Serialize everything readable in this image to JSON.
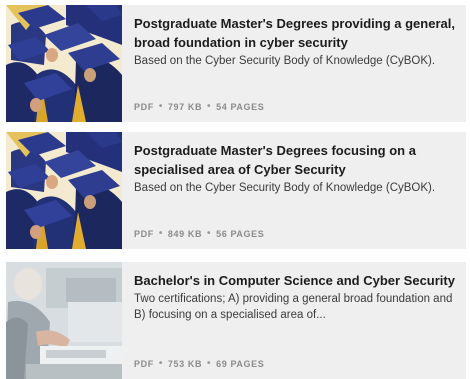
{
  "documents": [
    {
      "title": "Postgraduate Master's Degrees providing a general, broad foundation in cyber security",
      "description": "Based on the Cyber Security Body of Knowledge (CyBOK).",
      "format": "PDF",
      "size": "797 KB",
      "pages": "54 PAGES",
      "image": "graduation-caps"
    },
    {
      "title": "Postgraduate Master's Degrees focusing on a specialised area of Cyber Security",
      "description": "Based on the Cyber Security Body of Knowledge (CyBOK).",
      "format": "PDF",
      "size": "849 KB",
      "pages": "56 PAGES",
      "image": "graduation-caps"
    },
    {
      "title": "Bachelor's in Computer Science and Cyber Security",
      "description": "Two certifications; A) providing a general broad foundation and B) focusing on a specialised area of...",
      "format": "PDF",
      "size": "753 KB",
      "pages": "69 PAGES",
      "image": "person-at-computer"
    }
  ],
  "meta_separator": "•"
}
